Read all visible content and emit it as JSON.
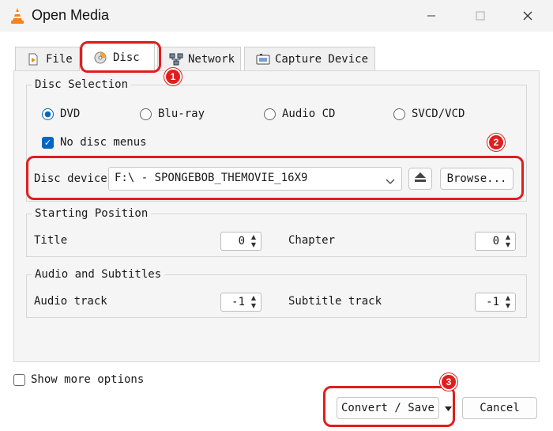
{
  "window": {
    "title": "Open Media",
    "minimize_icon": "minimize-icon",
    "maximize_icon": "maximize-icon",
    "close_icon": "close-icon"
  },
  "tabs": [
    {
      "label": "File",
      "icon": "file-icon"
    },
    {
      "label": "Disc",
      "icon": "disc-icon",
      "active": true
    },
    {
      "label": "Network",
      "icon": "network-icon"
    },
    {
      "label": "Capture Device",
      "icon": "capture-device-icon"
    }
  ],
  "disc_selection": {
    "title": "Disc Selection",
    "options": [
      "DVD",
      "Blu-ray",
      "Audio CD",
      "SVCD/VCD"
    ],
    "selected": "DVD",
    "no_disc_menus_label": "No disc menus",
    "no_disc_menus_checked": true,
    "device_label": "Disc device",
    "device_value": "F:\\ - SPONGEBOB_THEMOVIE_16X9",
    "browse_label": "Browse..."
  },
  "starting_position": {
    "title": "Starting Position",
    "title_label": "Title",
    "title_value": "0",
    "chapter_label": "Chapter",
    "chapter_value": "0"
  },
  "audio_subtitles": {
    "title": "Audio and Subtitles",
    "audio_label": "Audio track",
    "audio_value": "-1",
    "subtitle_label": "Subtitle track",
    "subtitle_value": "-1"
  },
  "footer": {
    "show_more_label": "Show more options",
    "show_more_checked": false,
    "convert_label": "Convert / Save",
    "cancel_label": "Cancel"
  },
  "annotations": {
    "badge1": "1",
    "badge2": "2",
    "badge3": "3",
    "color": "#e01e1e"
  }
}
